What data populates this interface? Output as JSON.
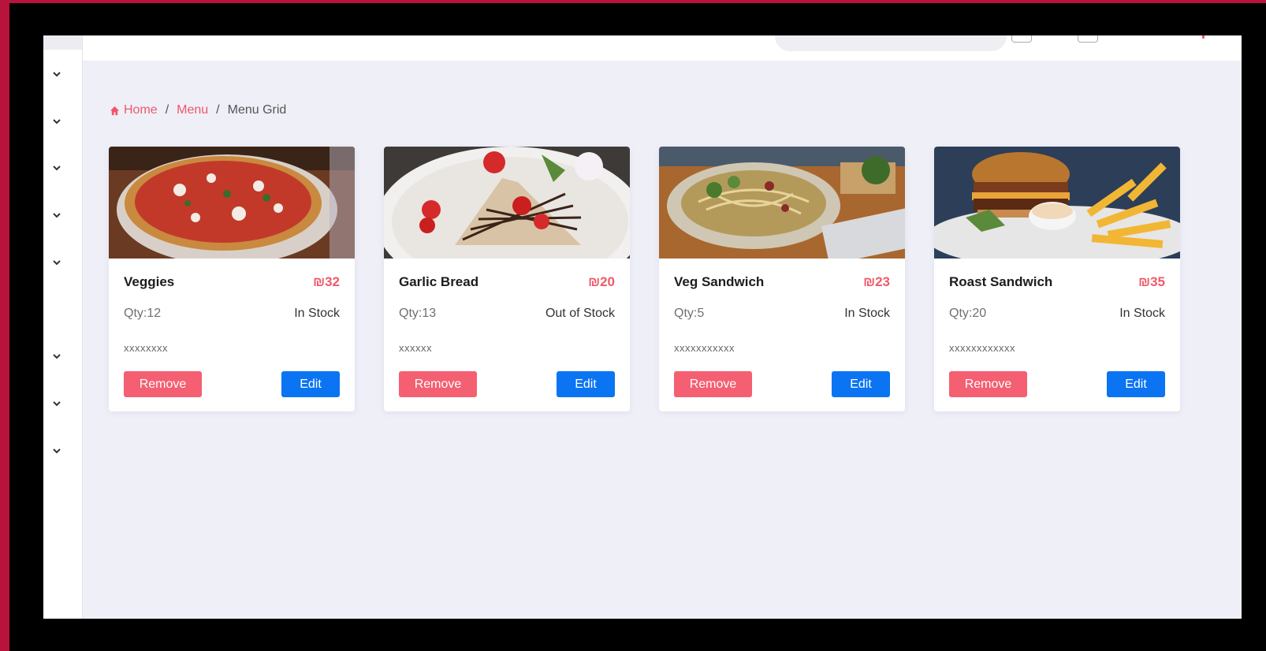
{
  "breadcrumb": {
    "home": "Home",
    "menu": "Menu",
    "current": "Menu Grid",
    "separator": "/"
  },
  "sidebar": {
    "chevron_count": 8
  },
  "colors": {
    "accent": "#f05a6a",
    "primary": "#0b74f2",
    "background": "#efeff8",
    "frame": "#b8133b"
  },
  "cards": [
    {
      "name": "Veggies",
      "price": "₪32",
      "qty": "Qty:12",
      "stock": "In Stock",
      "desc": "xxxxxxxx",
      "remove_label": "Remove",
      "edit_label": "Edit",
      "image": "pizza-photo"
    },
    {
      "name": "Garlic Bread",
      "price": "₪20",
      "qty": "Qty:13",
      "stock": "Out of Stock",
      "desc": "xxxxxx",
      "remove_label": "Remove",
      "edit_label": "Edit",
      "image": "crepe-photo"
    },
    {
      "name": "Veg Sandwich",
      "price": "₪23",
      "qty": "Qty:5",
      "stock": "In Stock",
      "desc": "xxxxxxxxxxx",
      "remove_label": "Remove",
      "edit_label": "Edit",
      "image": "pasta-photo"
    },
    {
      "name": "Roast Sandwich",
      "price": "₪35",
      "qty": "Qty:20",
      "stock": "In Stock",
      "desc": "xxxxxxxxxxxx",
      "remove_label": "Remove",
      "edit_label": "Edit",
      "image": "burger-photo"
    }
  ]
}
